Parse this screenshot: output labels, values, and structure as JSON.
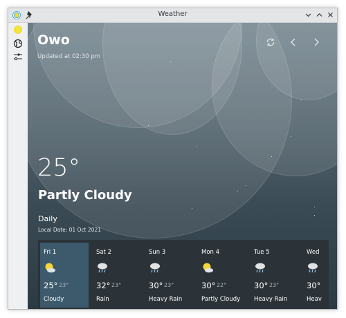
{
  "window": {
    "title": "Weather"
  },
  "location": {
    "name": "Owo",
    "updated": "Updated at 02:30 pm"
  },
  "current": {
    "temperature": "25°",
    "condition": "Partly Cloudy"
  },
  "daily": {
    "label": "Daily",
    "local_date": "Local Date: 01 Oct 2021",
    "days": [
      {
        "name": "Fri 1",
        "icon": "sun-cloud-icon",
        "high": "25°",
        "low": "23°",
        "desc": "Cloudy"
      },
      {
        "name": "Sat 2",
        "icon": "rain-cloud-icon",
        "high": "32°",
        "low": "23°",
        "desc": "Rain"
      },
      {
        "name": "Sun 3",
        "icon": "rain-cloud-icon",
        "high": "30°",
        "low": "23°",
        "desc": "Heavy Rain"
      },
      {
        "name": "Mon 4",
        "icon": "sun-cloud-icon",
        "high": "30°",
        "low": "22°",
        "desc": "Partly Cloudy"
      },
      {
        "name": "Tue 5",
        "icon": "rain-cloud-icon",
        "high": "30°",
        "low": "23°",
        "desc": "Heavy Rain"
      },
      {
        "name": "Wed",
        "icon": "rain-cloud-icon",
        "high": "30°",
        "low": "",
        "desc": "Heav"
      }
    ]
  },
  "colors": {
    "selected_card": "#3d5a6c",
    "strip_bg": "#2c3338",
    "sun": "#f5d53a"
  }
}
